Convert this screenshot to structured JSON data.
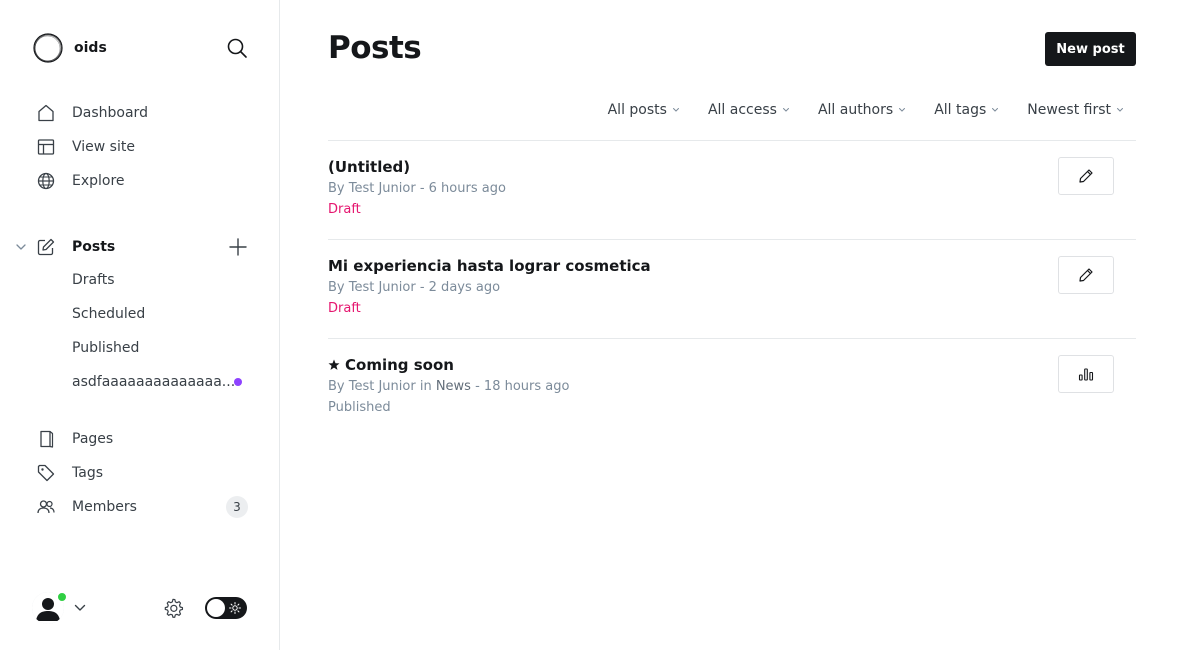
{
  "app": {
    "site_name": "oids"
  },
  "nav": {
    "dashboard": "Dashboard",
    "view_site": "View site",
    "explore": "Explore",
    "posts": "Posts",
    "drafts": "Drafts",
    "scheduled": "Scheduled",
    "published": "Published",
    "custom_view": "asdfaaaaaaaaaaaaaa...",
    "pages": "Pages",
    "tags": "Tags",
    "members": "Members",
    "members_count": "3"
  },
  "main": {
    "title": "Posts",
    "new_post_label": "New post",
    "filters": [
      "All posts",
      "All access",
      "All authors",
      "All tags",
      "Newest first"
    ],
    "posts": [
      {
        "title": "(Untitled)",
        "featured": false,
        "meta_prefix": "By Test Junior",
        "meta_tag_prefix": "",
        "meta_tag": "",
        "meta_time": " - 6 hours ago",
        "status": "Draft",
        "status_color": "#e5166f",
        "action_icon": "pencil-icon"
      },
      {
        "title": "Mi experiencia hasta lograr cosmetica",
        "featured": false,
        "meta_prefix": "By Test Junior",
        "meta_tag_prefix": "",
        "meta_tag": "",
        "meta_time": " - 2 days ago",
        "status": "Draft",
        "status_color": "#e5166f",
        "action_icon": "pencil-icon"
      },
      {
        "title": "Coming soon",
        "featured": true,
        "meta_prefix": "By Test Junior",
        "meta_tag_prefix": " in ",
        "meta_tag": "News",
        "meta_time": " - 18 hours ago",
        "status": "Published",
        "status_color": "#7c8b9a",
        "action_icon": "analytics-icon"
      }
    ]
  },
  "colors": {
    "accent_dark": "#15171a",
    "draft_pink": "#e5166f",
    "online_green": "#30cf43",
    "notification_purple": "#8e42ff"
  }
}
